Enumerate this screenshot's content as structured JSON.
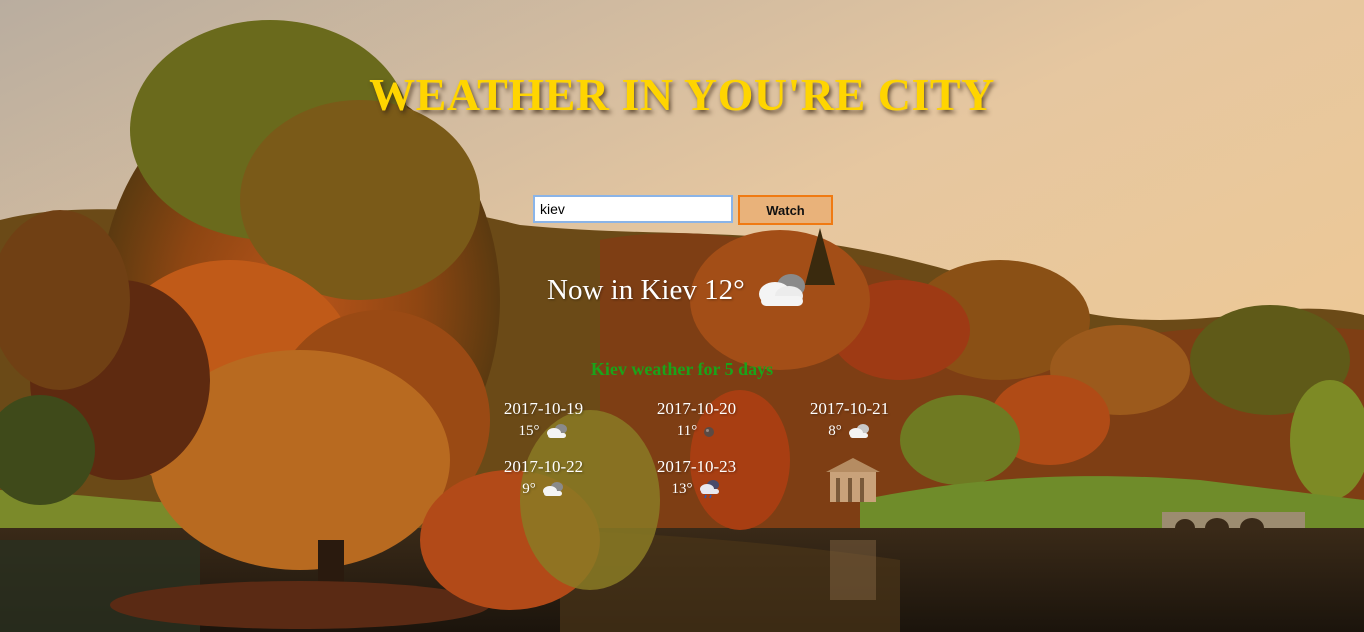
{
  "page": {
    "title": "WEATHER IN YOU'RE CITY"
  },
  "search": {
    "value": "kiev",
    "button_label": "Watch"
  },
  "current": {
    "text": "Now in Kiev 12°",
    "icon": "cloud-icon"
  },
  "forecast": {
    "title": "Kiev weather for 5 days",
    "days": [
      {
        "date": "2017-10-19",
        "temp": "15°",
        "icon": "cloud-icon"
      },
      {
        "date": "2017-10-20",
        "temp": "11°",
        "icon": "rain-drop-icon"
      },
      {
        "date": "2017-10-21",
        "temp": "8°",
        "icon": "cloud-icon"
      },
      {
        "date": "2017-10-22",
        "temp": "9°",
        "icon": "cloud-icon"
      },
      {
        "date": "2017-10-23",
        "temp": "13°",
        "icon": "rain-cloud-icon"
      }
    ]
  },
  "colors": {
    "title": "#ffd500",
    "forecast_title": "#1aa31a",
    "button_border": "#f07a12",
    "input_border": "#8ab4e8"
  }
}
